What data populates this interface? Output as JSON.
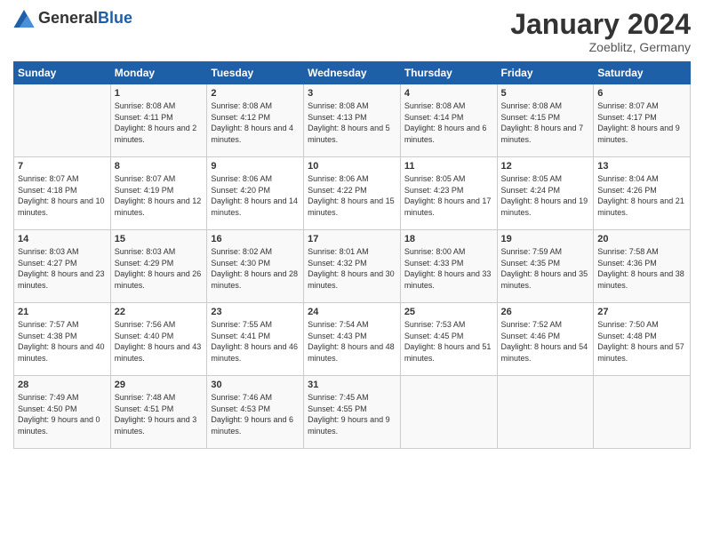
{
  "header": {
    "logo_general": "General",
    "logo_blue": "Blue",
    "month": "January 2024",
    "location": "Zoeblitz, Germany"
  },
  "days_of_week": [
    "Sunday",
    "Monday",
    "Tuesday",
    "Wednesday",
    "Thursday",
    "Friday",
    "Saturday"
  ],
  "weeks": [
    [
      {
        "day": "",
        "sunrise": "",
        "sunset": "",
        "daylight": ""
      },
      {
        "day": "1",
        "sunrise": "Sunrise: 8:08 AM",
        "sunset": "Sunset: 4:11 PM",
        "daylight": "Daylight: 8 hours and 2 minutes."
      },
      {
        "day": "2",
        "sunrise": "Sunrise: 8:08 AM",
        "sunset": "Sunset: 4:12 PM",
        "daylight": "Daylight: 8 hours and 4 minutes."
      },
      {
        "day": "3",
        "sunrise": "Sunrise: 8:08 AM",
        "sunset": "Sunset: 4:13 PM",
        "daylight": "Daylight: 8 hours and 5 minutes."
      },
      {
        "day": "4",
        "sunrise": "Sunrise: 8:08 AM",
        "sunset": "Sunset: 4:14 PM",
        "daylight": "Daylight: 8 hours and 6 minutes."
      },
      {
        "day": "5",
        "sunrise": "Sunrise: 8:08 AM",
        "sunset": "Sunset: 4:15 PM",
        "daylight": "Daylight: 8 hours and 7 minutes."
      },
      {
        "day": "6",
        "sunrise": "Sunrise: 8:07 AM",
        "sunset": "Sunset: 4:17 PM",
        "daylight": "Daylight: 8 hours and 9 minutes."
      }
    ],
    [
      {
        "day": "7",
        "sunrise": "Sunrise: 8:07 AM",
        "sunset": "Sunset: 4:18 PM",
        "daylight": "Daylight: 8 hours and 10 minutes."
      },
      {
        "day": "8",
        "sunrise": "Sunrise: 8:07 AM",
        "sunset": "Sunset: 4:19 PM",
        "daylight": "Daylight: 8 hours and 12 minutes."
      },
      {
        "day": "9",
        "sunrise": "Sunrise: 8:06 AM",
        "sunset": "Sunset: 4:20 PM",
        "daylight": "Daylight: 8 hours and 14 minutes."
      },
      {
        "day": "10",
        "sunrise": "Sunrise: 8:06 AM",
        "sunset": "Sunset: 4:22 PM",
        "daylight": "Daylight: 8 hours and 15 minutes."
      },
      {
        "day": "11",
        "sunrise": "Sunrise: 8:05 AM",
        "sunset": "Sunset: 4:23 PM",
        "daylight": "Daylight: 8 hours and 17 minutes."
      },
      {
        "day": "12",
        "sunrise": "Sunrise: 8:05 AM",
        "sunset": "Sunset: 4:24 PM",
        "daylight": "Daylight: 8 hours and 19 minutes."
      },
      {
        "day": "13",
        "sunrise": "Sunrise: 8:04 AM",
        "sunset": "Sunset: 4:26 PM",
        "daylight": "Daylight: 8 hours and 21 minutes."
      }
    ],
    [
      {
        "day": "14",
        "sunrise": "Sunrise: 8:03 AM",
        "sunset": "Sunset: 4:27 PM",
        "daylight": "Daylight: 8 hours and 23 minutes."
      },
      {
        "day": "15",
        "sunrise": "Sunrise: 8:03 AM",
        "sunset": "Sunset: 4:29 PM",
        "daylight": "Daylight: 8 hours and 26 minutes."
      },
      {
        "day": "16",
        "sunrise": "Sunrise: 8:02 AM",
        "sunset": "Sunset: 4:30 PM",
        "daylight": "Daylight: 8 hours and 28 minutes."
      },
      {
        "day": "17",
        "sunrise": "Sunrise: 8:01 AM",
        "sunset": "Sunset: 4:32 PM",
        "daylight": "Daylight: 8 hours and 30 minutes."
      },
      {
        "day": "18",
        "sunrise": "Sunrise: 8:00 AM",
        "sunset": "Sunset: 4:33 PM",
        "daylight": "Daylight: 8 hours and 33 minutes."
      },
      {
        "day": "19",
        "sunrise": "Sunrise: 7:59 AM",
        "sunset": "Sunset: 4:35 PM",
        "daylight": "Daylight: 8 hours and 35 minutes."
      },
      {
        "day": "20",
        "sunrise": "Sunrise: 7:58 AM",
        "sunset": "Sunset: 4:36 PM",
        "daylight": "Daylight: 8 hours and 38 minutes."
      }
    ],
    [
      {
        "day": "21",
        "sunrise": "Sunrise: 7:57 AM",
        "sunset": "Sunset: 4:38 PM",
        "daylight": "Daylight: 8 hours and 40 minutes."
      },
      {
        "day": "22",
        "sunrise": "Sunrise: 7:56 AM",
        "sunset": "Sunset: 4:40 PM",
        "daylight": "Daylight: 8 hours and 43 minutes."
      },
      {
        "day": "23",
        "sunrise": "Sunrise: 7:55 AM",
        "sunset": "Sunset: 4:41 PM",
        "daylight": "Daylight: 8 hours and 46 minutes."
      },
      {
        "day": "24",
        "sunrise": "Sunrise: 7:54 AM",
        "sunset": "Sunset: 4:43 PM",
        "daylight": "Daylight: 8 hours and 48 minutes."
      },
      {
        "day": "25",
        "sunrise": "Sunrise: 7:53 AM",
        "sunset": "Sunset: 4:45 PM",
        "daylight": "Daylight: 8 hours and 51 minutes."
      },
      {
        "day": "26",
        "sunrise": "Sunrise: 7:52 AM",
        "sunset": "Sunset: 4:46 PM",
        "daylight": "Daylight: 8 hours and 54 minutes."
      },
      {
        "day": "27",
        "sunrise": "Sunrise: 7:50 AM",
        "sunset": "Sunset: 4:48 PM",
        "daylight": "Daylight: 8 hours and 57 minutes."
      }
    ],
    [
      {
        "day": "28",
        "sunrise": "Sunrise: 7:49 AM",
        "sunset": "Sunset: 4:50 PM",
        "daylight": "Daylight: 9 hours and 0 minutes."
      },
      {
        "day": "29",
        "sunrise": "Sunrise: 7:48 AM",
        "sunset": "Sunset: 4:51 PM",
        "daylight": "Daylight: 9 hours and 3 minutes."
      },
      {
        "day": "30",
        "sunrise": "Sunrise: 7:46 AM",
        "sunset": "Sunset: 4:53 PM",
        "daylight": "Daylight: 9 hours and 6 minutes."
      },
      {
        "day": "31",
        "sunrise": "Sunrise: 7:45 AM",
        "sunset": "Sunset: 4:55 PM",
        "daylight": "Daylight: 9 hours and 9 minutes."
      },
      {
        "day": "",
        "sunrise": "",
        "sunset": "",
        "daylight": ""
      },
      {
        "day": "",
        "sunrise": "",
        "sunset": "",
        "daylight": ""
      },
      {
        "day": "",
        "sunrise": "",
        "sunset": "",
        "daylight": ""
      }
    ]
  ]
}
